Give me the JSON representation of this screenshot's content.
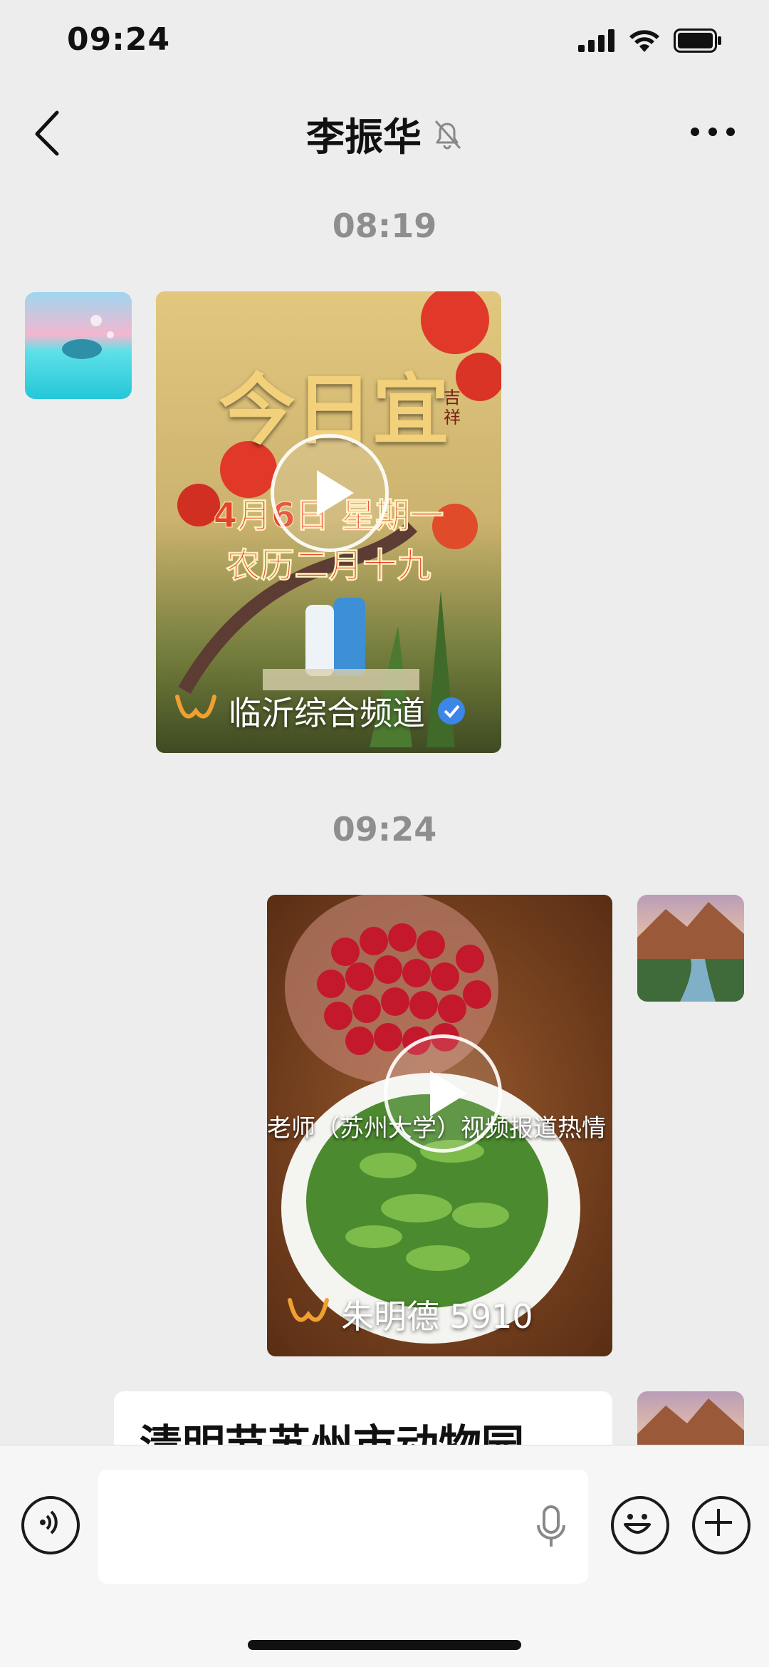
{
  "status_bar": {
    "time": "09:24",
    "battery_icon": "battery-icon",
    "wifi_icon": "wifi-icon",
    "signal_icon": "signal-icon"
  },
  "header": {
    "title": "李振华",
    "mute_icon": "bell-muted-icon",
    "back_icon": "chevron-left-icon",
    "more_icon": "more-dots-icon"
  },
  "messages": {
    "timestamp_1": "08:19",
    "video_1": {
      "overlay_line1": "今日宜",
      "overlay_small": "吉祥",
      "overlay_date": "4月6日 星期一",
      "overlay_lunar": "农历二月十九",
      "channel_name": "临沂综合频道",
      "verified_icon": "verified-badge-icon"
    },
    "timestamp_2": "09:24",
    "video_2": {
      "caption": "老师（苏州大学）视频报道热情",
      "channel_name": "朱明德 5910"
    },
    "text_message": "清明节苏州市动物园"
  },
  "input_bar": {
    "voice_icon": "voice-toggle-icon",
    "mic_icon": "microphone-icon",
    "emoji_icon": "emoji-icon",
    "add_icon": "plus-icon",
    "input_value": ""
  },
  "colors": {
    "background": "#ededed",
    "verified": "#3c86e8",
    "channels_logo": "#f0a030"
  }
}
